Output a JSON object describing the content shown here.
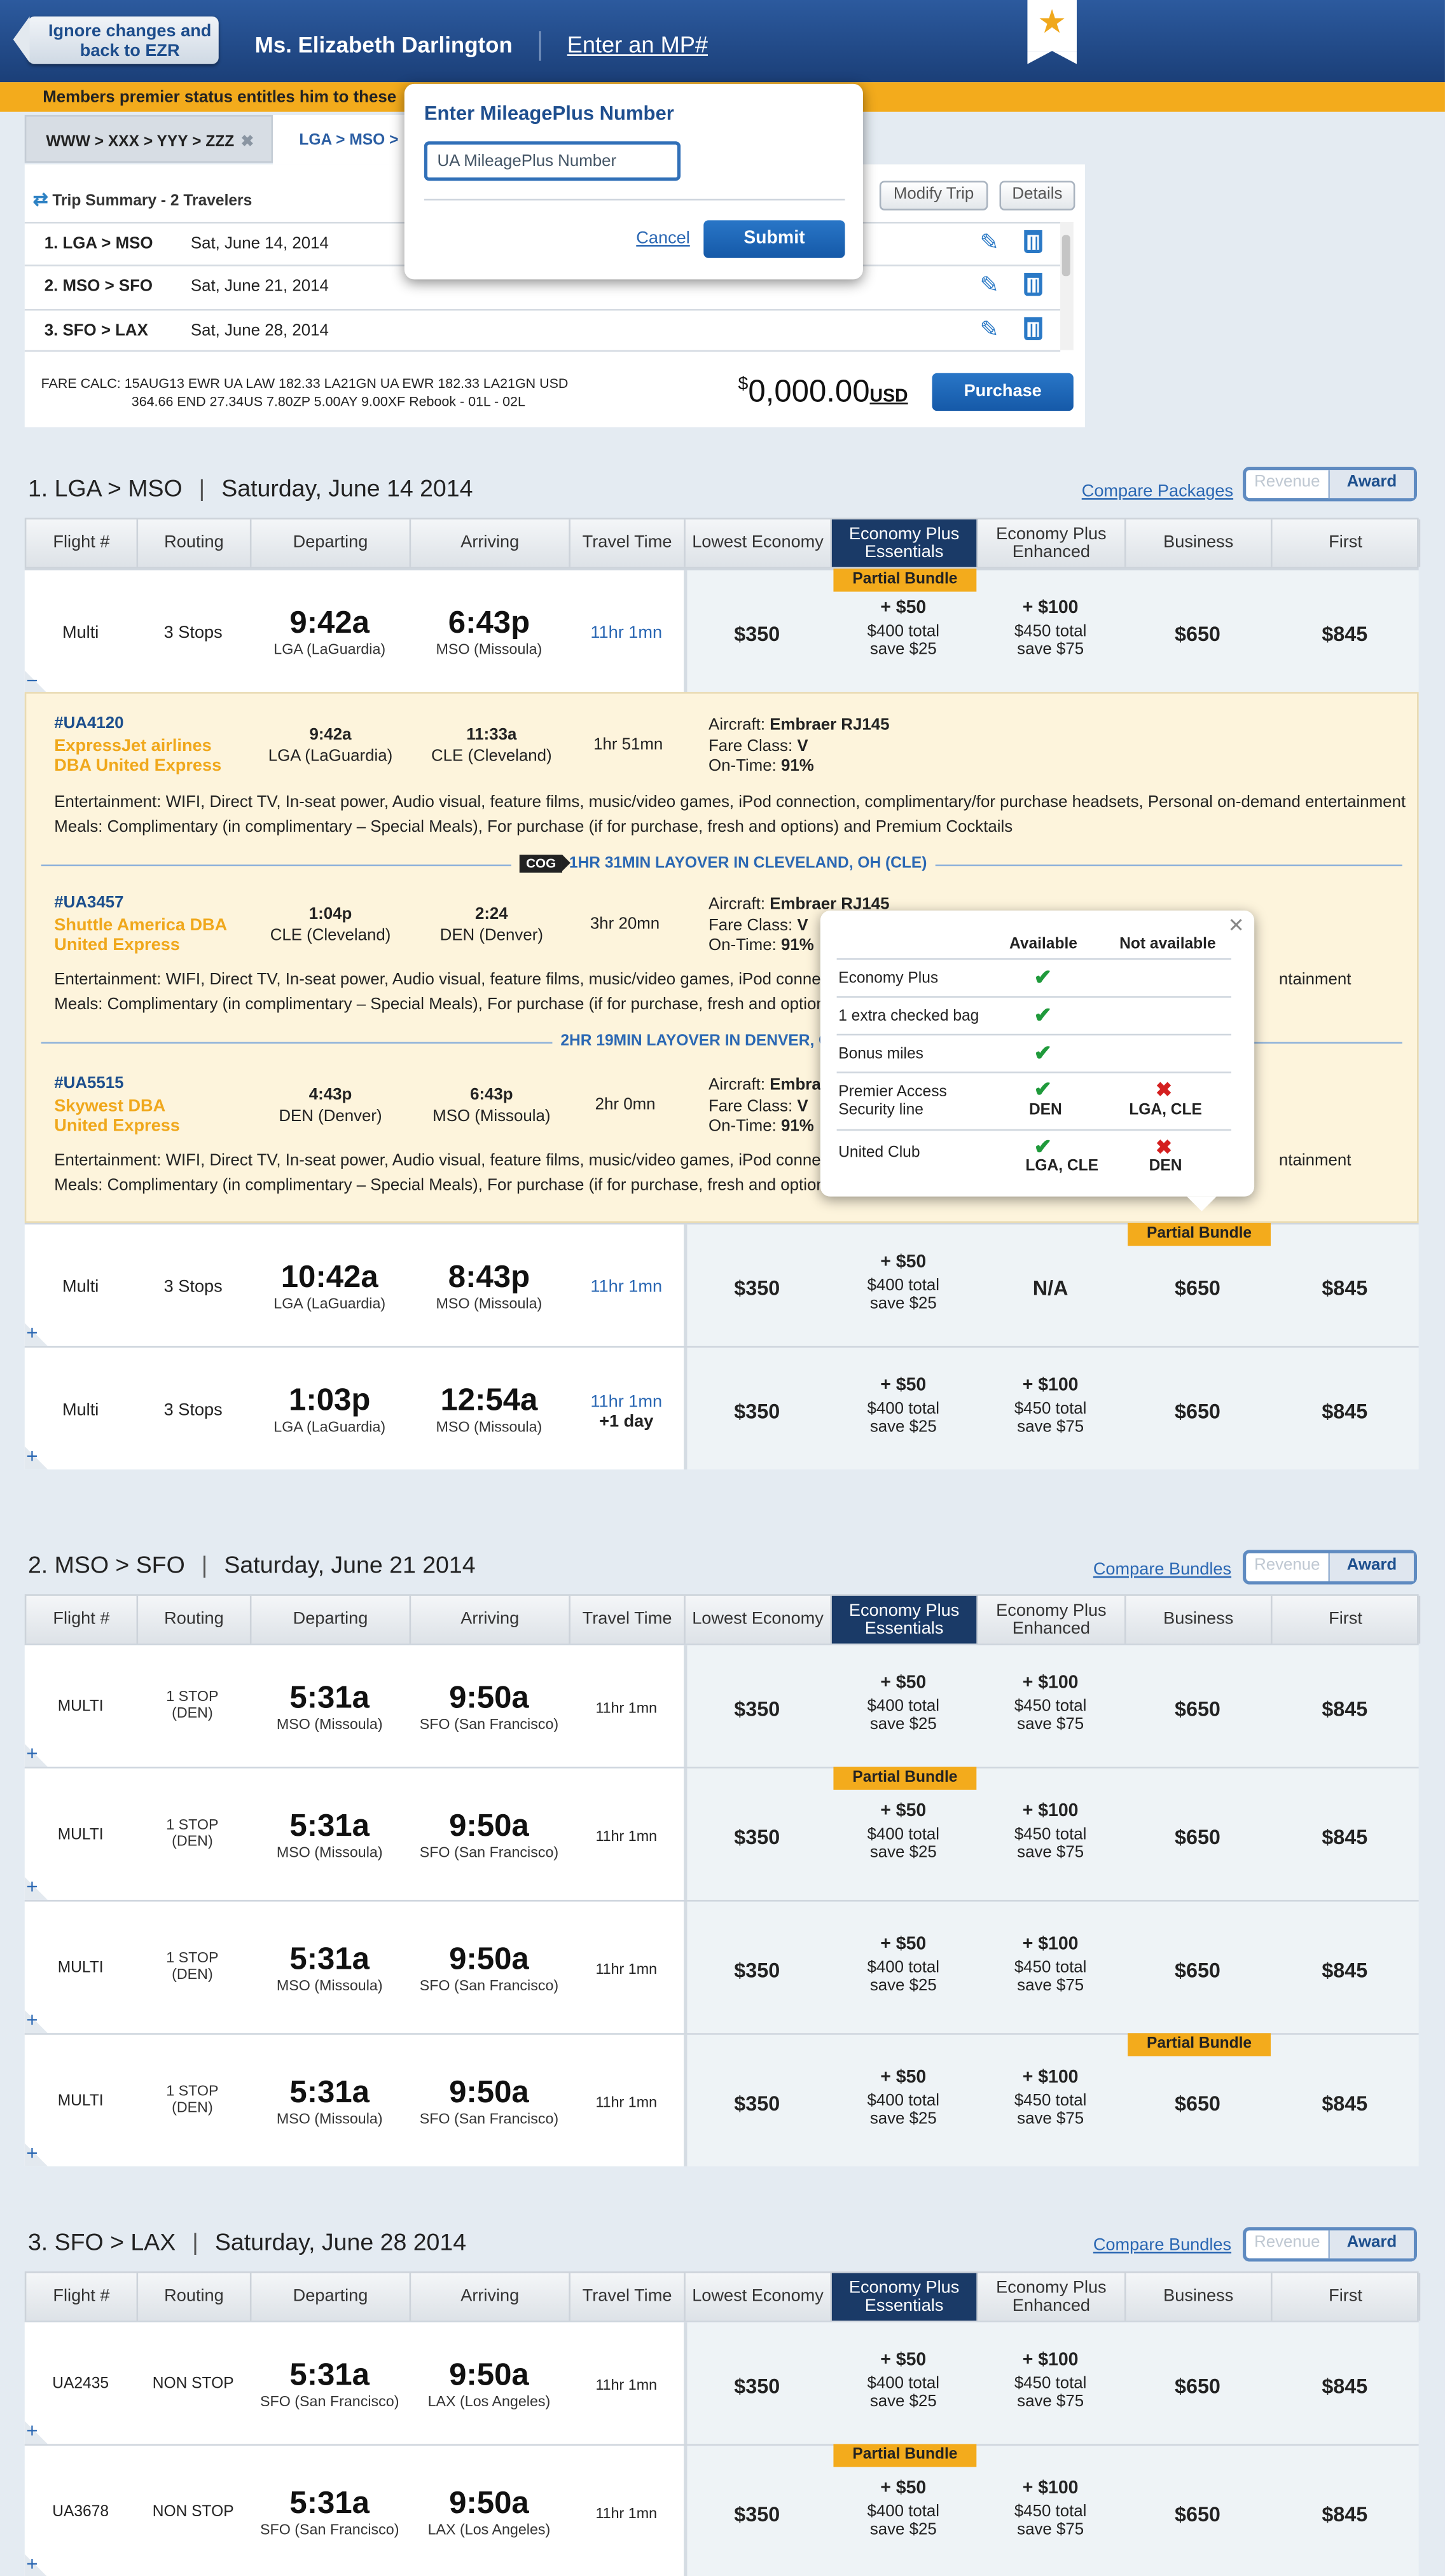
{
  "header": {
    "back_label": "Ignore changes and back to EZR",
    "passenger_name": "Ms. Elizabeth Darlington",
    "mp_link": "Enter an MP#"
  },
  "banner": {
    "text": "Members premier status entitles him to these"
  },
  "tabs": [
    "WWW > XXX > YYY > ZZZ",
    "LGA > MSO >"
  ],
  "trip_summary": {
    "title": "Trip Summary - 2 Travelers",
    "modify_label": "Modify Trip",
    "details_label": "Details",
    "legs": [
      {
        "route": "1. LGA > MSO",
        "date": "Sat, June 14, 2014"
      },
      {
        "route": "2. MSO > SFO",
        "date": "Sat, June 21, 2014"
      },
      {
        "route": "3. SFO > LAX",
        "date": "Sat, June 28, 2014"
      }
    ],
    "fare_calc_1": "FARE CALC: 15AUG13 EWR UA LAW 182.33 LA21GN UA EWR 182.33 LA21GN USD",
    "fare_calc_2": "364.66 END 27.34US 7.80ZP 5.00AY 9.00XF Rebook - 01L - 02L",
    "price_sym": "$",
    "price_amount": "0,000.00",
    "price_currency": "USD",
    "purchase_label": "Purchase"
  },
  "mp_popup": {
    "title": "Enter MileagePlus Number",
    "placeholder": "UA MileagePlus Number",
    "cancel": "Cancel",
    "submit": "Submit"
  },
  "columns": {
    "flight": "Flight #",
    "routing": "Routing",
    "departing": "Departing",
    "arriving": "Arriving",
    "travel": "Travel Time",
    "lowest": "Lowest Economy",
    "epe": "Economy Plus Essentials",
    "epn": "Economy Plus Enhanced",
    "business": "Business",
    "first": "First"
  },
  "toggle": {
    "revenue": "Revenue",
    "award": "Award"
  },
  "partial_bundle": "Partial Bundle",
  "section1": {
    "title": "1. LGA > MSO",
    "date": "Saturday, June 14 2014",
    "compare": "Compare Packages",
    "rows": [
      {
        "flight": "Multi",
        "routing": "3 Stops",
        "dep_time": "9:42a",
        "dep_city": "LGA (LaGuardia)",
        "arr_time": "6:43p",
        "arr_city": "MSO (Missoula)",
        "travel": "11hr 1mn",
        "travel2": "",
        "lowest": "$350",
        "epe": "+ $50",
        "epe_total": "$400 total",
        "epe_save": "save $25",
        "epn": "+ $100",
        "epn_total": "$450 total",
        "epn_save": "save $75",
        "business": "$650",
        "first": "$845"
      },
      {
        "flight": "Multi",
        "routing": "3 Stops",
        "dep_time": "10:42a",
        "dep_city": "LGA (LaGuardia)",
        "arr_time": "8:43p",
        "arr_city": "MSO (Missoula)",
        "travel": "11hr 1mn",
        "travel2": "",
        "lowest": "$350",
        "epe": "+ $50",
        "epe_total": "$400 total",
        "epe_save": "save $25",
        "epn": "N/A",
        "business": "$650",
        "first": "$845"
      },
      {
        "flight": "Multi",
        "routing": "3 Stops",
        "dep_time": "1:03p",
        "dep_city": "LGA (LaGuardia)",
        "arr_time": "12:54a",
        "arr_city": "MSO (Missoula)",
        "travel": "11hr 1mn",
        "travel2": "+1 day",
        "lowest": "$350",
        "epe": "+ $50",
        "epe_total": "$400 total",
        "epe_save": "save $25",
        "epn": "+ $100",
        "epn_total": "$450 total",
        "epn_save": "save $75",
        "business": "$650",
        "first": "$845"
      }
    ],
    "detail": {
      "segments": [
        {
          "flight": "#UA4120",
          "airline1": "ExpressJet airlines",
          "airline2": "DBA United Express",
          "dep": "9:42a",
          "dep_city": "LGA (LaGuardia)",
          "arr": "11:33a",
          "arr_city": "CLE (Cleveland)",
          "dur": "1hr 51mn",
          "aircraft": "Embraer RJ145",
          "fare_class": "V",
          "ontime": "91%"
        },
        {
          "flight": "#UA3457",
          "airline1": "Shuttle America DBA",
          "airline2": "United Express",
          "dep": "1:04p",
          "dep_city": "CLE (Cleveland)",
          "arr": "2:24",
          "arr_city": "DEN (Denver)",
          "dur": "3hr 20mn",
          "aircraft": "Embraer RJ145",
          "fare_class": "V",
          "ontime": "91%"
        },
        {
          "flight": "#UA5515",
          "airline1": "Skywest DBA",
          "airline2": "United Express",
          "dep": "4:43p",
          "dep_city": "DEN (Denver)",
          "arr": "6:43p",
          "arr_city": "MSO (Missoula)",
          "dur": "2hr 0mn",
          "aircraft": "Embra",
          "fare_class": "V",
          "ontime": "91%"
        }
      ],
      "aircraft_label": "Aircraft:",
      "fare_class_label": "Fare Class:",
      "ontime_label": "On-Time:",
      "ent_full": "Entertainment: WIFI, Direct TV, In-seat power, Audio visual, feature films, music/video games, iPod connection, complimentary/for purchase headsets, Personal on-demand entertainment",
      "meals_full": "Meals: Complimentary (in complimentary – Special Meals), For purchase (if for purchase, fresh and options) and Premium Cocktails",
      "ent_short": "Entertainment: WIFI, Direct TV, In-seat power, Audio visual, feature films, music/video games, iPod connection, co",
      "ent_tail": "ntainment",
      "meals_short": "Meals: Complimentary (in complimentary – Special Meals), For purchase (if for purchase, fresh and options) and",
      "cog": "COG",
      "layover1": "1HR 31MIN LAYOVER IN CLEVELAND, OH (CLE)",
      "layover2": "2HR 19MIN LAYOVER IN DENVER, C"
    }
  },
  "availability": {
    "available": "Available",
    "not_available": "Not available",
    "rows": [
      {
        "label": "Economy Plus"
      },
      {
        "label": "1 extra checked bag"
      },
      {
        "label": "Bonus miles"
      },
      {
        "label": "Premier Access Security line",
        "avail_code": "DEN",
        "not_code": "LGA, CLE"
      },
      {
        "label": "United Club",
        "avail_code": "LGA, CLE",
        "not_code": "DEN"
      }
    ]
  },
  "section2": {
    "title": "2. MSO > SFO",
    "date": "Saturday, June 21 2014",
    "compare": "Compare Bundles",
    "rows": [
      {
        "flight": "MULTI",
        "routing": "1 STOP (DEN)",
        "dep_time": "5:31a",
        "dep_city": "MSO (Missoula)",
        "arr_time": "9:50a",
        "arr_city": "SFO (San Francisco)",
        "travel": "11hr 1mn",
        "lowest": "$350",
        "epe": "+ $50",
        "epe_total": "$400 total",
        "epe_save": "save $25",
        "epn": "+ $100",
        "epn_total": "$450 total",
        "epn_save": "save $75",
        "business": "$650",
        "first": "$845"
      },
      {
        "flight": "MULTI",
        "routing": "1 STOP (DEN)",
        "dep_time": "5:31a",
        "dep_city": "MSO (Missoula)",
        "arr_time": "9:50a",
        "arr_city": "SFO (San Francisco)",
        "travel": "11hr 1mn",
        "lowest": "$350",
        "epe": "+ $50",
        "epe_total": "$400 total",
        "epe_save": "save $25",
        "epn": "+ $100",
        "epn_total": "$450 total",
        "epn_save": "save $75",
        "business": "$650",
        "first": "$845"
      },
      {
        "flight": "MULTI",
        "routing": "1 STOP (DEN)",
        "dep_time": "5:31a",
        "dep_city": "MSO (Missoula)",
        "arr_time": "9:50a",
        "arr_city": "SFO (San Francisco)",
        "travel": "11hr 1mn",
        "lowest": "$350",
        "epe": "+ $50",
        "epe_total": "$400 total",
        "epe_save": "save $25",
        "epn": "+ $100",
        "epn_total": "$450 total",
        "epn_save": "save $75",
        "business": "$650",
        "first": "$845"
      },
      {
        "flight": "MULTI",
        "routing": "1 STOP (DEN)",
        "dep_time": "5:31a",
        "dep_city": "MSO (Missoula)",
        "arr_time": "9:50a",
        "arr_city": "SFO (San Francisco)",
        "travel": "11hr 1mn",
        "lowest": "$350",
        "epe": "+ $50",
        "epe_total": "$400 total",
        "epe_save": "save $25",
        "epn": "+ $100",
        "epn_total": "$450 total",
        "epn_save": "save $75",
        "business": "$650",
        "first": "$845"
      }
    ]
  },
  "section3": {
    "title": "3. SFO > LAX",
    "date": "Saturday, June 28 2014",
    "compare": "Compare Bundles",
    "rows": [
      {
        "flight": "UA2435",
        "routing": "NON STOP",
        "dep_time": "5:31a",
        "dep_city": "SFO (San Francisco)",
        "arr_time": "9:50a",
        "arr_city": "LAX (Los Angeles)",
        "travel": "11hr 1mn",
        "lowest": "$350",
        "epe": "+ $50",
        "epe_total": "$400 total",
        "epe_save": "save $25",
        "epn": "+ $100",
        "epn_total": "$450 total",
        "epn_save": "save $75",
        "business": "$650",
        "first": "$845"
      },
      {
        "flight": "UA3678",
        "routing": "NON STOP",
        "dep_time": "5:31a",
        "dep_city": "SFO (San Francisco)",
        "arr_time": "9:50a",
        "arr_city": "LAX (Los Angeles)",
        "travel": "11hr 1mn",
        "lowest": "$350",
        "epe": "+ $50",
        "epe_total": "$400 total",
        "epe_save": "save $25",
        "epn": "+ $100",
        "epn_total": "$450 total",
        "epn_save": "save $75",
        "business": "$650",
        "first": "$845"
      }
    ]
  },
  "colors": {
    "brand_blue": "#1b3f78",
    "accent_yellow": "#f3ab1c",
    "selected_col": "#1a3a67",
    "check_green": "#1f9a3b",
    "cross_red": "#d41f1f"
  }
}
